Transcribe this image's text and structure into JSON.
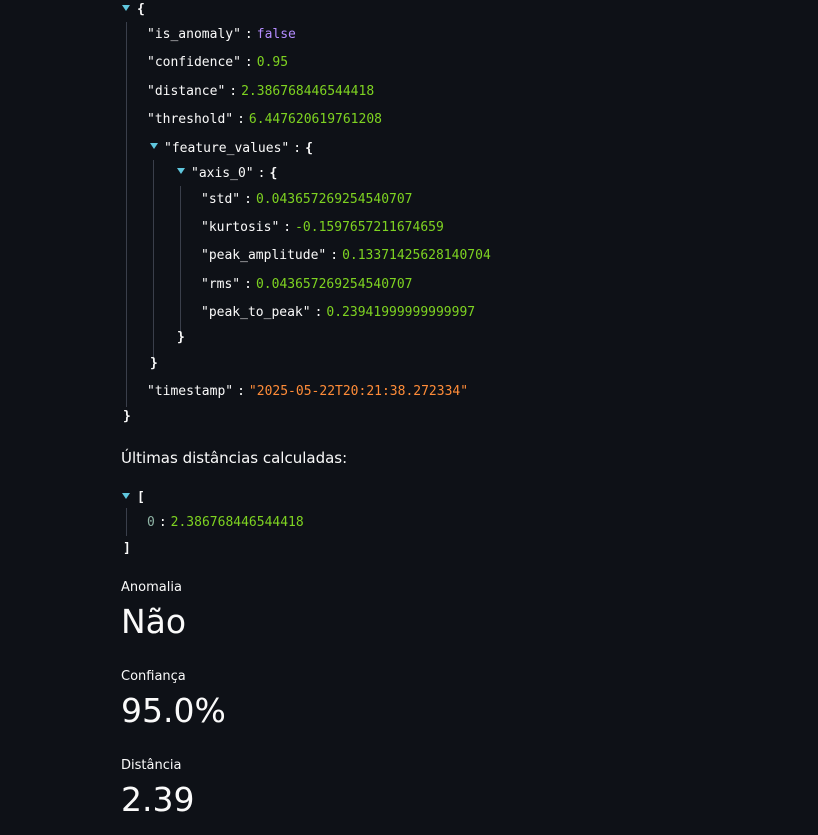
{
  "json_result": {
    "open_brace": "{",
    "close_brace": "}",
    "is_anomaly": {
      "key": "\"is_anomaly\"",
      "value": "false"
    },
    "confidence": {
      "key": "\"confidence\"",
      "value": "0.95"
    },
    "distance": {
      "key": "\"distance\"",
      "value": "2.386768446544418"
    },
    "threshold": {
      "key": "\"threshold\"",
      "value": "6.447620619761208"
    },
    "feature_values": {
      "key": "\"feature_values\"",
      "open": "{",
      "close": "}",
      "axis_0": {
        "key": "\"axis_0\"",
        "open": "{",
        "close": "}",
        "std": {
          "key": "\"std\"",
          "value": "0.043657269254540707"
        },
        "kurtosis": {
          "key": "\"kurtosis\"",
          "value": "-0.1597657211674659"
        },
        "peak_amplitude": {
          "key": "\"peak_amplitude\"",
          "value": "0.13371425628140704"
        },
        "rms": {
          "key": "\"rms\"",
          "value": "0.043657269254540707"
        },
        "peak_to_peak": {
          "key": "\"peak_to_peak\"",
          "value": "0.23941999999999997"
        }
      }
    },
    "timestamp": {
      "key": "\"timestamp\"",
      "value": "\"2025-05-22T20:21:38.272334\""
    },
    "colon": ":"
  },
  "distances_section": {
    "title": "Últimas distâncias calculadas:",
    "open": "[",
    "close": "]",
    "items": [
      {
        "index": "0",
        "value": "2.386768446544418"
      }
    ]
  },
  "metrics": [
    {
      "label": "Anomalia",
      "value": "Não"
    },
    {
      "label": "Confiança",
      "value": "95.0%"
    },
    {
      "label": "Distância",
      "value": "2.39"
    }
  ],
  "colors": {
    "background": "#0e1117",
    "string": "#ff8c38",
    "number": "#7ed321",
    "boolean": "#b48cff",
    "toggle": "#5fc7de"
  }
}
